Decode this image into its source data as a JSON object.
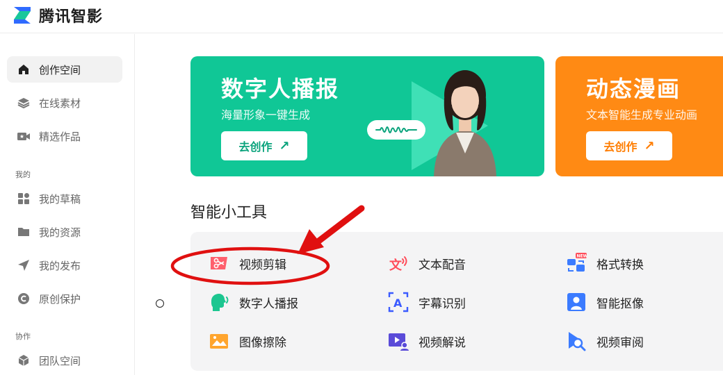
{
  "app": {
    "brand": "腾讯智影"
  },
  "sidebar": {
    "items": [
      {
        "label": "创作空间",
        "icon": "home-icon",
        "active": true
      },
      {
        "label": "在线素材",
        "icon": "layers-icon"
      },
      {
        "label": "精选作品",
        "icon": "video-star-icon"
      }
    ],
    "group_mine": "我的",
    "mine_items": [
      {
        "label": "我的草稿",
        "icon": "grid-icon"
      },
      {
        "label": "我的资源",
        "icon": "folder-icon"
      },
      {
        "label": "我的发布",
        "icon": "send-icon"
      },
      {
        "label": "原创保护",
        "icon": "copyright-icon"
      }
    ],
    "group_collab": "协作",
    "collab_items": [
      {
        "label": "团队空间",
        "icon": "cube-icon"
      }
    ]
  },
  "banners": [
    {
      "title": "数字人播报",
      "subtitle": "海量形象一键生成",
      "button": "去创作",
      "color": "#10c796"
    },
    {
      "title": "动态漫画",
      "subtitle": "文本智能生成专业动画",
      "button": "去创作",
      "color": "#ff8a14"
    }
  ],
  "tools": {
    "title": "智能小工具",
    "items": [
      {
        "label": "视频剪辑",
        "icon": "scissors-icon"
      },
      {
        "label": "文本配音",
        "icon": "text-voice-icon"
      },
      {
        "label": "格式转换",
        "icon": "format-convert-icon",
        "badge": "NEW"
      },
      {
        "label": "数字人播报",
        "icon": "speaking-head-icon"
      },
      {
        "label": "字幕识别",
        "icon": "subtitle-recognition-icon"
      },
      {
        "label": "智能抠像",
        "icon": "portrait-cutout-icon"
      },
      {
        "label": "图像擦除",
        "icon": "image-erase-icon"
      },
      {
        "label": "视频解说",
        "icon": "video-narration-icon"
      },
      {
        "label": "视频审阅",
        "icon": "video-review-icon"
      }
    ]
  },
  "colors": {
    "accent_green": "#10c796",
    "accent_orange": "#ff8a14",
    "annotation_red": "#e01010"
  }
}
